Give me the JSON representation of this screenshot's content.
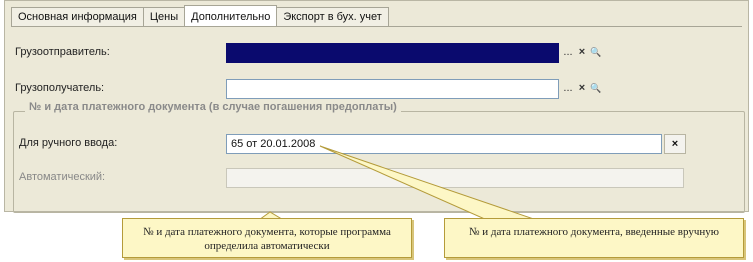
{
  "tabs": [
    {
      "label": "Основная информация",
      "active": false
    },
    {
      "label": "Цены",
      "active": false
    },
    {
      "label": "Дополнительно",
      "active": true
    },
    {
      "label": "Экспорт в бух. учет",
      "active": false
    }
  ],
  "fields": {
    "shipper": {
      "label": "Грузоотправитель:",
      "value": ""
    },
    "consignee": {
      "label": "Грузополучатель:",
      "value": ""
    }
  },
  "group": {
    "title": "№ и дата платежного документа (в случае погашения предоплаты)",
    "manual": {
      "label": "Для ручного ввода:",
      "value": "65 от 20.01.2008"
    },
    "auto": {
      "label": "Автоматический:",
      "value": ""
    }
  },
  "buttons": {
    "select": "...",
    "clear": "×",
    "open": "🔍"
  },
  "callouts": {
    "auto": "№ и дата платежного документа, которые программа определила автоматически",
    "manual": "№ и дата платежного документа, введенные вручную"
  },
  "colors": {
    "selected_field": "#0a0a6e",
    "callout_bg": "#fdf7c6"
  }
}
